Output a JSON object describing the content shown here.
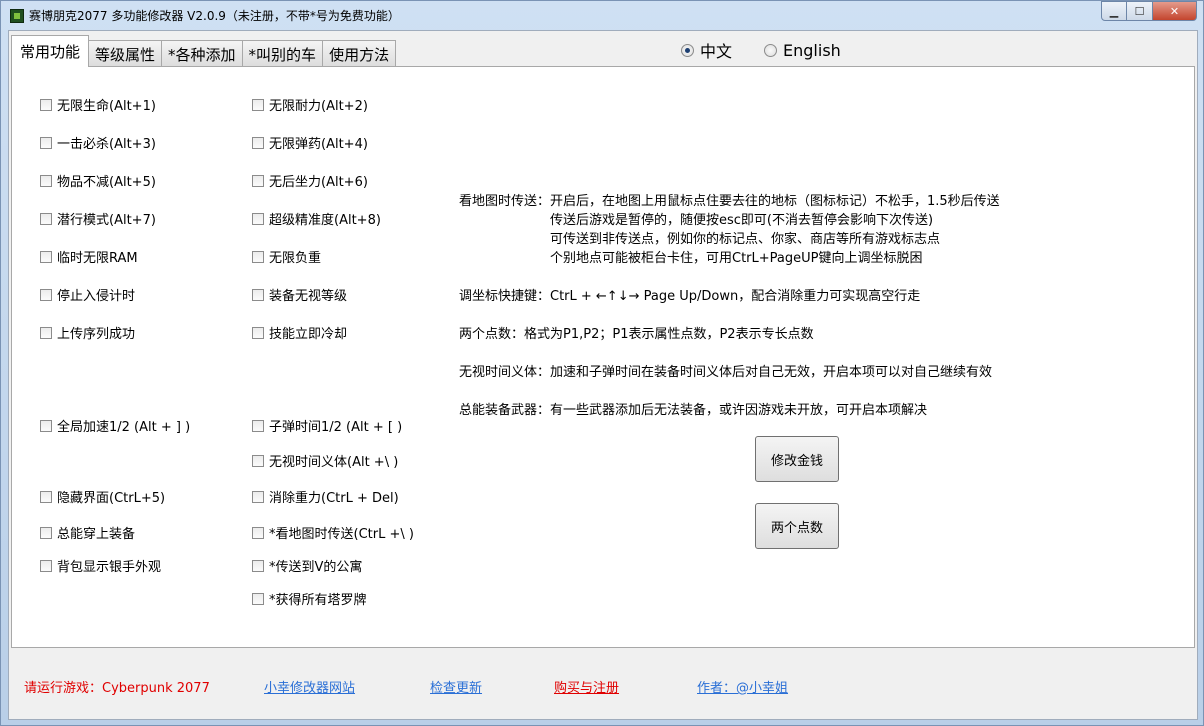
{
  "window": {
    "title": "赛博朋克2077 多功能修改器  V2.0.9（未注册，不带*号为免费功能）",
    "icon": "app-icon",
    "min_label": "▁",
    "max_label": "☐",
    "close_label": "✕"
  },
  "tabs": [
    {
      "label": "常用功能",
      "active": true
    },
    {
      "label": "等级属性"
    },
    {
      "label": "*各种添加"
    },
    {
      "label": "*叫别的车"
    },
    {
      "label": "使用方法"
    }
  ],
  "language": {
    "options": [
      {
        "label": "中文",
        "checked": true
      },
      {
        "label": "English",
        "checked": false
      }
    ]
  },
  "left_column": [
    "无限生命(Alt+1)",
    "一击必杀(Alt+3)",
    "物品不减(Alt+5)",
    "潜行模式(Alt+7)",
    "临时无限RAM",
    "停止入侵计时",
    "上传序列成功",
    "全局加速1/2 (Alt + ] )",
    "隐藏界面(CtrL+5)",
    "总能穿上装备",
    "背包显示银手外观"
  ],
  "right_column": [
    "无限耐力(Alt+2)",
    "无限弹药(Alt+4)",
    "无后坐力(Alt+6)",
    "超级精准度(Alt+8)",
    "无限负重",
    "装备无视等级",
    "技能立即冷却",
    "子弹时间1/2 (Alt + [ )",
    "无视时间义体(Alt +\\ )",
    "消除重力(CtrL + Del)",
    "*看地图时传送(CtrL +\\ )",
    "*传送到V的公寓",
    "*获得所有塔罗牌"
  ],
  "info": {
    "map_teleport": "看地图时传送：开启后，在地图上用鼠标点住要去往的地标（图标标记）不松手，1.5秒后传送",
    "map_teleport_l2": "传送后游戏是暂停的，随便按esc即可(不消去暂停会影响下次传送)",
    "map_teleport_l3": "可传送到非传送点，例如你的标记点、你家、商店等所有游戏标志点",
    "map_teleport_l4": "个别地点可能被柜台卡住，可用CtrL+PageUP键向上调坐标脱困",
    "coords_hotkey": "调坐标快捷键：CtrL + ←↑↓→ Page Up/Down，配合消除重力可实现高空行走",
    "two_points": "两个点数：格式为P1,P2；P1表示属性点数，P2表示专长点数",
    "ignore_time_implant": "无视时间义体：加速和子弹时间在装备时间义体后对自己无效，开启本项可以对自己继续有效",
    "always_equip": "总能装备武器：有一些武器添加后无法装备，或许因游戏未开放，可开启本项解决"
  },
  "buttons": {
    "modify_money": "修改金钱",
    "two_points": "两个点数"
  },
  "footer": {
    "status": "请运行游戏：Cyberpunk 2077",
    "website": "小幸修改器网站",
    "check_update": "检查更新",
    "buy_register": "购买与注册",
    "author": "作者：@小幸姐"
  }
}
